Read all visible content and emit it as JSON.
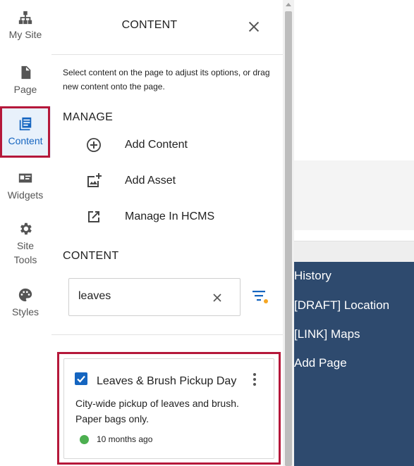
{
  "sidebar": {
    "items": [
      {
        "label": "My Site",
        "icon": "sitemap-icon"
      },
      {
        "label": "Page",
        "icon": "page-icon"
      },
      {
        "label": "Content",
        "icon": "content-icon",
        "active": true
      },
      {
        "label": "Widgets",
        "icon": "widgets-icon"
      },
      {
        "label": "Site Tools",
        "icon": "gear-icon"
      },
      {
        "label": "Styles",
        "icon": "palette-icon"
      }
    ]
  },
  "panel": {
    "title": "CONTENT",
    "description": "Select content on the page to adjust its options, or drag new content onto the page.",
    "manage": {
      "title": "MANAGE",
      "items": [
        {
          "label": "Add Content",
          "icon": "add-circle-icon"
        },
        {
          "label": "Add Asset",
          "icon": "add-image-icon"
        },
        {
          "label": "Manage In HCMS",
          "icon": "external-link-icon"
        }
      ]
    },
    "content": {
      "title": "CONTENT",
      "search_value": "leaves"
    },
    "card": {
      "title": "Leaves & Brush Pickup Day",
      "description": "City-wide pickup of leaves and brush. Paper bags only.",
      "time": "10 months ago",
      "checked": true,
      "status_color": "#4caf50"
    }
  },
  "background_nav": {
    "items": [
      "History",
      "[DRAFT] Location",
      "[LINK] Maps",
      "Add Page"
    ]
  },
  "colors": {
    "accent": "#1565c0",
    "highlight_outline": "#b5183a",
    "nav_background": "#2e4a6e",
    "filter_dot": "#f5a623"
  }
}
